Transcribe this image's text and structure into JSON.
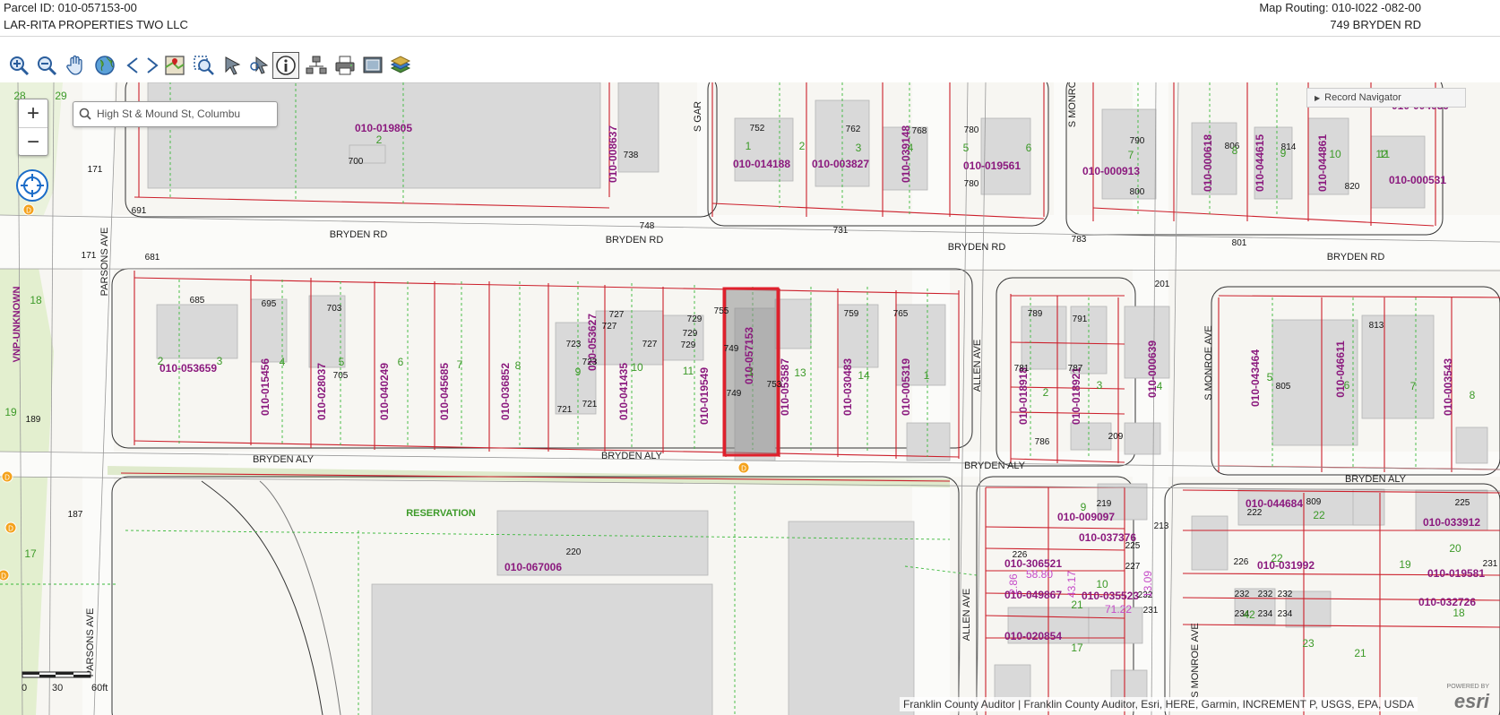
{
  "header": {
    "parcel_id": "Parcel ID: 010-057153-00",
    "owner": "LAR-RITA PROPERTIES TWO LLC",
    "map_routing": "Map Routing: 010-I022 -082-00",
    "address": "749 BRYDEN RD"
  },
  "toolbar": {
    "tools": [
      {
        "name": "zoom-in-tool-button",
        "icon": "zoom-in-icon"
      },
      {
        "name": "zoom-out-tool-button",
        "icon": "zoom-out-icon"
      },
      {
        "name": "pan-tool-button",
        "icon": "hand-icon"
      },
      {
        "name": "full-extent-button",
        "icon": "globe-icon"
      },
      {
        "name": "previous-extent-button",
        "icon": "arrow-left-icon"
      },
      {
        "name": "next-extent-button",
        "icon": "arrow-right-icon"
      },
      {
        "name": "zoom-to-parcel-button",
        "icon": "map-pin-icon"
      },
      {
        "name": "select-area-button",
        "icon": "magnify-box-icon"
      },
      {
        "name": "select-parcel-button",
        "icon": "pointer-arrow-icon"
      },
      {
        "name": "select-by-point-button",
        "icon": "pointer-select-icon"
      },
      {
        "name": "identify-button",
        "icon": "info-icon",
        "active": true
      },
      {
        "name": "buffer-tool-button",
        "icon": "buffer-icon"
      },
      {
        "name": "print-button",
        "icon": "printer-icon"
      },
      {
        "name": "fullscreen-button",
        "icon": "screen-icon"
      },
      {
        "name": "layers-button",
        "icon": "layers-icon"
      }
    ]
  },
  "map": {
    "search": {
      "value": "High St & Mound St, Columbu"
    },
    "zoom_in_label": "+",
    "zoom_out_label": "−",
    "record_navigator": "Record Navigator",
    "attribution": "Franklin County Auditor | Franklin County Auditor, Esri, HERE, Garmin, INCREMENT P, USGS, EPA, USDA",
    "scale": {
      "label_0": "0",
      "label_30": "30",
      "label_60": "60ft"
    },
    "esri_label": "esri",
    "powered_by": "POWERED BY",
    "colors": {
      "parcel_line": "#cc1f2b",
      "parcel_id_text": "#8b1a7e",
      "lot_number": "#3c9a28",
      "selected_parcel": "#e0202c",
      "building": "#d9d9d9"
    },
    "streets": [
      "BRYDEN RD",
      "BRYDEN RD",
      "BRYDEN RD",
      "BRYDEN RD",
      "BRYDEN ALY",
      "BRYDEN ALY",
      "BRYDEN ALY",
      "BRYDEN ALY",
      "PARSONS AVE",
      "PARSONS AVE",
      "ALLEN AVE",
      "ALLEN AVE",
      "S MONROE AVE",
      "S MONROE AVE",
      "S GAR",
      "S MONRO",
      "VNP-UNKNOWN",
      "RESERVATION"
    ],
    "parcel_ids": [
      "010-019805",
      "010-008637",
      "010-014188",
      "010-003827",
      "010-039148",
      "010-019561",
      "010-000913",
      "010-000618",
      "010-044615",
      "010-044861",
      "010-000531",
      "010-004039",
      "010-053659",
      "010-015456",
      "010-028037",
      "010-040249",
      "010-045685",
      "010-036852",
      "010-053627",
      "010-041435",
      "010-019549",
      "010-057153",
      "010-053587",
      "010-030483",
      "010-005319",
      "010-018918",
      "010-018921",
      "010-000639",
      "010-043464",
      "010-046611",
      "010-003543",
      "010-067006",
      "010-009097",
      "010-037376",
      "010-306521",
      "010-049867",
      "010-035523",
      "010-020854",
      "010-044684",
      "010-031992",
      "010-019581",
      "010-033912",
      "010-032726"
    ],
    "house_numbers": [
      "700",
      "738",
      "752",
      "762",
      "768",
      "780",
      "780",
      "790",
      "800",
      "806",
      "814",
      "820",
      "681",
      "685",
      "695",
      "703",
      "705",
      "723",
      "723",
      "727",
      "727",
      "727",
      "729",
      "729",
      "729",
      "721",
      "721",
      "749",
      "749",
      "755",
      "753",
      "759",
      "765",
      "789",
      "791",
      "781",
      "787",
      "786",
      "209",
      "813",
      "805",
      "220",
      "219",
      "225",
      "226",
      "227",
      "232",
      "231",
      "222",
      "809",
      "225",
      "231",
      "232",
      "232",
      "232",
      "234",
      "234",
      "234",
      "226",
      "748",
      "731",
      "783",
      "801",
      "189",
      "171",
      "187",
      "213",
      "201",
      "171",
      "691"
    ],
    "lot_numbers": [
      "28",
      "29",
      "18",
      "19",
      "17",
      "2",
      "1",
      "2",
      "3",
      "4",
      "5",
      "6",
      "7",
      "8",
      "9",
      "10",
      "11",
      "12",
      "13",
      "14",
      "1",
      "2",
      "3",
      "4",
      "5",
      "6",
      "7",
      "8",
      "9",
      "10",
      "11",
      "1",
      "2",
      "3",
      "4",
      "5",
      "6",
      "7",
      "8",
      "9",
      "10",
      "21",
      "22",
      "22",
      "19",
      "20",
      "18",
      "17",
      "42",
      "23",
      "21"
    ],
    "dimension_labels": [
      "58.80",
      "43.17",
      "71.22",
      "13.09",
      "2.86"
    ]
  }
}
